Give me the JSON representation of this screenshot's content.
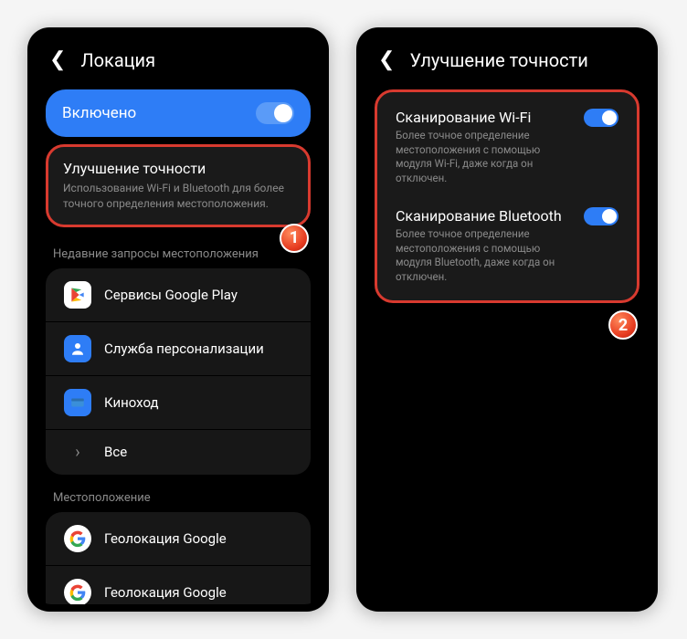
{
  "left": {
    "header_title": "Локация",
    "enabled_label": "Включено",
    "accuracy": {
      "title": "Улучшение точности",
      "subtitle": "Использование Wi-Fi и Bluetooth для более точного определения местоположения."
    },
    "section_recent": "Недавние запросы местоположения",
    "apps": [
      {
        "label": "Сервисы Google Play"
      },
      {
        "label": "Служба персонализации"
      },
      {
        "label": "Киноход"
      },
      {
        "label": "Все"
      }
    ],
    "section_location": "Местоположение",
    "geo_items": [
      {
        "label": "Геолокация Google"
      },
      {
        "label": "Геолокация Google"
      }
    ],
    "badge": "1"
  },
  "right": {
    "header_title": "Улучшение точности",
    "scans": [
      {
        "title": "Сканирование Wi-Fi",
        "subtitle": "Более точное определение местоположения с помощью модуля Wi-Fi, даже когда он отключен."
      },
      {
        "title": "Сканирование Bluetooth",
        "subtitle": "Более точное определение местоположения с помощью модуля Bluetooth, даже когда он отключен."
      }
    ],
    "badge": "2"
  }
}
